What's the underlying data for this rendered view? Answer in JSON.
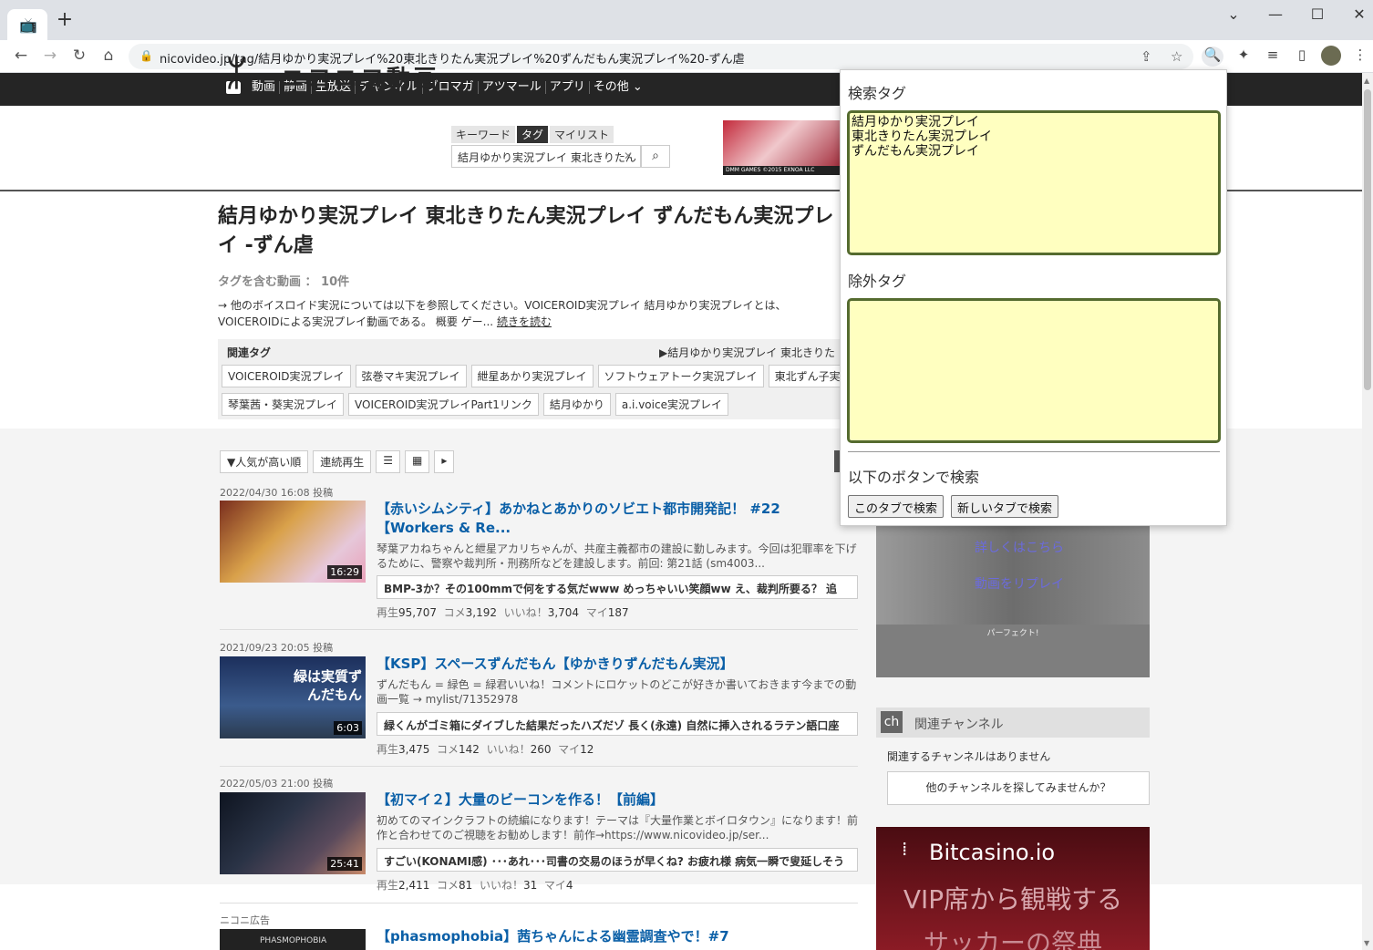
{
  "browser": {
    "tab_icon": "tv-icon",
    "new_tab": "+",
    "window_controls": {
      "chevron": "⌄",
      "minimize": "—",
      "maximize": "☐",
      "close": "✕"
    },
    "url": "nicovideo.jp/tag/結月ゆかり実況プレイ%20東北きりたん実況プレイ%20ずんだもん実況プレイ%20-ずん虐"
  },
  "topnav": {
    "items": [
      "動画",
      "静画",
      "生放送",
      "チャンネル",
      "ブロマガ",
      "アツマール",
      "アプリ",
      "その他 ⌄"
    ]
  },
  "header": {
    "logo": "ニコニコ動画",
    "search_tabs": [
      "キーワード",
      "タグ",
      "マイリスト"
    ],
    "search_value": "結月ゆかり実況プレイ 東北きりたん",
    "banner_text": "DMM GAMES ©2015 EXNOA LLC"
  },
  "tag_page": {
    "title": "結月ゆかり実況プレイ 東北きりたん実況プレイ ずんだもん実況プレイ -ずん虐",
    "count": "タグを含む動画 ： 10件",
    "desc": "→ 他のボイスロイド実況については以下を参照してください。VOICEROID実況プレイ 結月ゆかり実況プレイとは、VOICEROIDによる実況プレイ動画である。 概要 ゲー...",
    "read_more": "続きを読む",
    "related_label": "関連タグ",
    "related_right": "▶結月ゆかり実況プレイ 東北きりた",
    "tags_row1": [
      "VOICEROID実況プレイ",
      "弦巻マキ実況プレイ",
      "紲星あかり実況プレイ",
      "ソフトウェアトーク実況プレイ",
      "東北ずん子実"
    ],
    "tags_row2": [
      "琴葉茜・葵実況プレイ",
      "VOICEROID実況プレイPart1リンク",
      "結月ゆかり",
      "a.i.voice実況プレイ"
    ]
  },
  "sortbar": [
    "▼人気が高い順",
    "連続再生",
    "☰",
    "▦",
    "▸"
  ],
  "videos": [
    {
      "date": "2022/04/30 16:08 投稿",
      "duration": "16:29",
      "title": "【赤いシムシティ】あかねとあかりのソビエト都市開発記！ #22【Workers & Re...",
      "desc": "琴葉アカねちゃんと紲星アカリちゃんが、共産主義都市の建設に勤しみます。今回は犯罪率を下げるために、警察や裁判所・刑務所などを建設します。前回: 第21話 (sm4003...",
      "comment": "BMP-3か？その100mmで何をする気だwww めっちゃいい笑顔ww え、裁判所要る？ 追",
      "stats": [
        "再生",
        "95,707",
        "コメ",
        "3,192",
        "いいね！",
        "3,704",
        "マイ",
        "187"
      ]
    },
    {
      "date": "2021/09/23 20:05 投稿",
      "duration": "6:03",
      "thumb_text": "緑は実質ずんだもん",
      "title": "【KSP】スペースずんだもん【ゆかきりずんだもん実況】",
      "desc": "ずんだもん = 緑色 = 緑君いいね！コメントにロケットのどこが好きか書いておきます今までの動画一覧 → mylist/71352978",
      "comment": "緑くんがゴミ箱にダイブした結果だったハズだゾ 長く(永遠) 自然に挿入されるラテン語口座",
      "stats": [
        "再生",
        "3,475",
        "コメ",
        "142",
        "いいね！",
        "260",
        "マイ",
        "12"
      ]
    },
    {
      "date": "2022/05/03 21:00 投稿",
      "duration": "25:41",
      "title": "【初マイ２】大量のビーコンを作る！【前編】",
      "desc": "初めてのマインクラフトの続編になります！テーマは『大量作業とボイロタウン』になります！前作と合わせてのご視聴をお勧めします！前作→https://www.nicovideo.jp/ser...",
      "comment": "すごい(KONAMI感) ･･･あれ･･･司書の交易のほうが早くね? お疲れ様 病気一瞬で叟延しそう",
      "stats": [
        "再生",
        "2,411",
        "コメ",
        "81",
        "いいね！",
        "31",
        "マイ",
        "4"
      ]
    },
    {
      "date": "ニコニ広告",
      "thumb_text": "PHASMOPHOBIA",
      "title": "【phasmophobia】茜ちゃんによる幽霊調査やで！#7"
    }
  ],
  "sidebar": {
    "ad_link1": "詳しくはこちら",
    "ad_link2": "動画をリプレイ",
    "ad_caption": "パーフェクト!",
    "channel_label": "関連チャンネル",
    "channel_none": "関連するチャンネルはありません",
    "channel_button": "他のチャンネルを探してみませんか？",
    "bitcasino_logo": "Bitcasino.io",
    "bitcasino_text": "VIP席から観戦する",
    "bitcasino_text2": "サッカーの祭典"
  },
  "popup": {
    "search_label": "検索タグ",
    "search_tags": "結月ゆかり実況プレイ\n東北きりたん実況プレイ\nずんだもん実況プレイ",
    "exclude_label": "除外タグ",
    "exclude_tags": "",
    "button_prompt": "以下のボタンで検索",
    "btn_this_tab": "このタブで検索",
    "btn_new_tab": "新しいタブで検索"
  }
}
